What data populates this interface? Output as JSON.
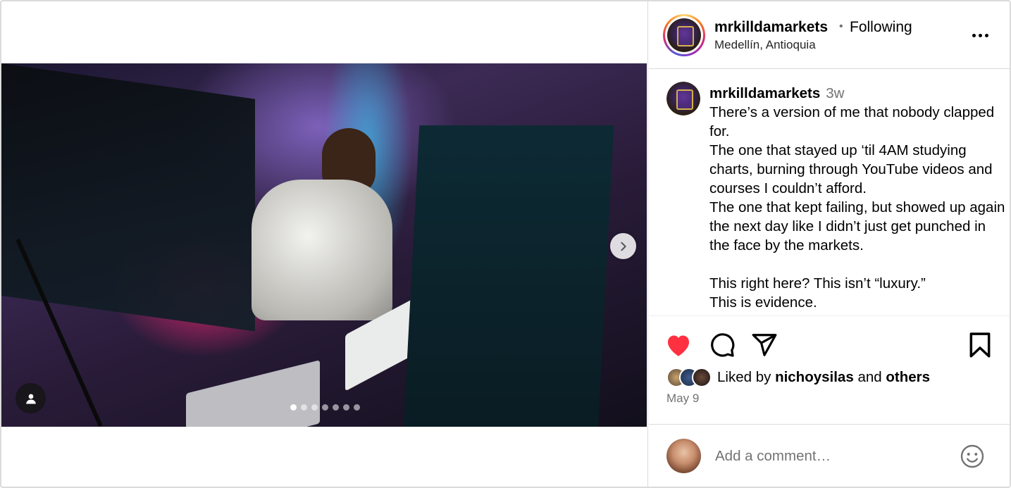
{
  "post": {
    "username": "mrkilldamarkets",
    "separator": "•",
    "follow_status": "Following",
    "location": "Medellín, Antioquia"
  },
  "media": {
    "carousel_count": 7,
    "active_index": 0,
    "icons": {
      "person_tag": "person-icon",
      "next": "chevron-right-icon"
    }
  },
  "caption": {
    "username": "mrkilldamarkets",
    "time_ago": "3w",
    "lines": [
      "There’s a version of me that nobody clapped for.",
      "The one that stayed up ‘til 4AM studying charts, burning through YouTube videos and courses I couldn’t afford.",
      "The one that kept failing, but showed up again the next day like I didn’t just get punched in the face by the markets.",
      "",
      "This right here? This isn’t “luxury.”",
      "This is evidence."
    ]
  },
  "actions": {
    "liked": true,
    "like_color": "#ff3040",
    "icons": [
      "heart-icon",
      "comment-icon",
      "share-icon",
      "bookmark-icon"
    ]
  },
  "likes": {
    "prefix": "Liked by",
    "user": "nichoysilas",
    "conjunction": "and",
    "others": "others"
  },
  "date": "May 9",
  "comment": {
    "placeholder": "Add a comment…"
  }
}
